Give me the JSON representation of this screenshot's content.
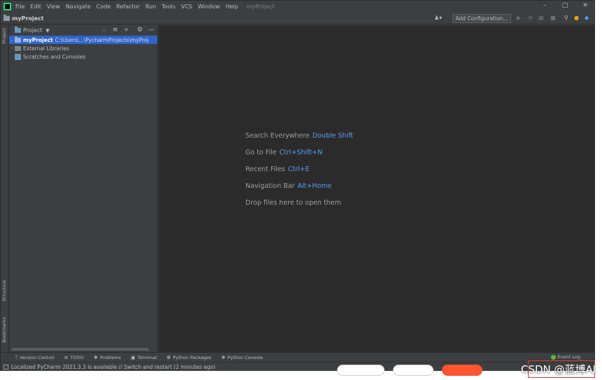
{
  "menu": {
    "items": [
      "File",
      "Edit",
      "View",
      "Navigate",
      "Code",
      "Refactor",
      "Run",
      "Tools",
      "VCS",
      "Window",
      "Help"
    ],
    "project_label": "myProject"
  },
  "window_controls": [
    "minimize-icon",
    "maximize-icon",
    "close-icon"
  ],
  "navbar": {
    "project": "myProject",
    "add_configuration": "Add Configuration..."
  },
  "left_strip": {
    "project": "Project",
    "structure": "Structure",
    "bookmarks": "Bookmarks"
  },
  "project_panel": {
    "title": "Project",
    "tree": {
      "root_name": "myProject",
      "root_path": "C:\\Users\\...\\PycharmProjects\\myProj",
      "external_libraries": "External Libraries",
      "scratches": "Scratches and Consoles"
    }
  },
  "editor": {
    "hints": [
      {
        "label": "Search Everywhere",
        "key": "Double Shift"
      },
      {
        "label": "Go to File",
        "key": "Ctrl+Shift+N"
      },
      {
        "label": "Recent Files",
        "key": "Ctrl+E"
      },
      {
        "label": "Navigation Bar",
        "key": "Alt+Home"
      }
    ],
    "drop_text": "Drop files here to open them"
  },
  "bottom_tools": {
    "version_control": "Version Control",
    "todo": "TODO",
    "problems": "Problems",
    "terminal": "Terminal",
    "python_packages": "Python Packages",
    "python_console": "Python Console",
    "event_log": "Event Log"
  },
  "status": {
    "message": "Localized PyCharm 2021.3.3 is available // Switch and restart (2 minutes ago)"
  },
  "watermark": "CSDN @蓝博AI",
  "colors": {
    "selection": "#2f65ca",
    "editor_bg": "#2b2b2b",
    "panel_bg": "#3c3f41",
    "hint_key": "#589df6"
  }
}
